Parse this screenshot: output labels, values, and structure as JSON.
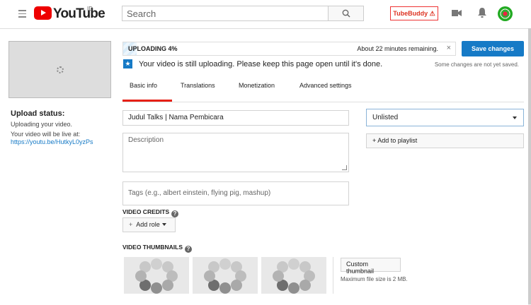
{
  "header": {
    "logo_text": "YouTube",
    "country_code": "ID",
    "search_placeholder": "Search",
    "tubebuddy_label": "TubeBuddy ⚠"
  },
  "sidebar": {
    "upload_status_title": "Upload status:",
    "upload_status_text": "Uploading your video.",
    "live_at_text": "Your video will be live at:",
    "video_link": "https://youtu.be/HutkyL0yzPs"
  },
  "upload": {
    "label": "UPLOADING 4%",
    "progress_fraction": 0.04,
    "time_remaining": "About 22 minutes remaining.",
    "close_glyph": "×",
    "save_label": "Save changes",
    "unsaved_text": "Some changes are not yet saved.",
    "info_text": "Your video is still uploading. Please keep this page open until it's done."
  },
  "tabs": [
    {
      "label": "Basic info",
      "active": true
    },
    {
      "label": "Translations",
      "active": false
    },
    {
      "label": "Monetization",
      "active": false
    },
    {
      "label": "Advanced settings",
      "active": false
    }
  ],
  "form": {
    "title_value": "Judul Talks | Nama Pembicara",
    "description_placeholder": "Description",
    "tags_placeholder": "Tags (e.g., albert einstein, flying pig, mashup)",
    "visibility_value": "Unlisted",
    "add_playlist_label": "+ Add to playlist",
    "video_credits_label": "VIDEO CREDITS",
    "add_role_label": "Add role",
    "thumbnails_label": "VIDEO THUMBNAILS",
    "custom_thumbnail_label": "Custom thumbnail",
    "max_file_size": "Maximum file size is 2 MB."
  },
  "colors": {
    "brand_red": "#ee0000",
    "accent_blue": "#167ac6",
    "tab_underline": "#e62117"
  },
  "icons": [
    "menu-icon",
    "youtube-logo",
    "search-icon",
    "camera-icon",
    "bell-icon",
    "avatar",
    "star-info-icon",
    "help-icon",
    "plus-icon",
    "chevron-down-icon",
    "spinner-icon"
  ]
}
